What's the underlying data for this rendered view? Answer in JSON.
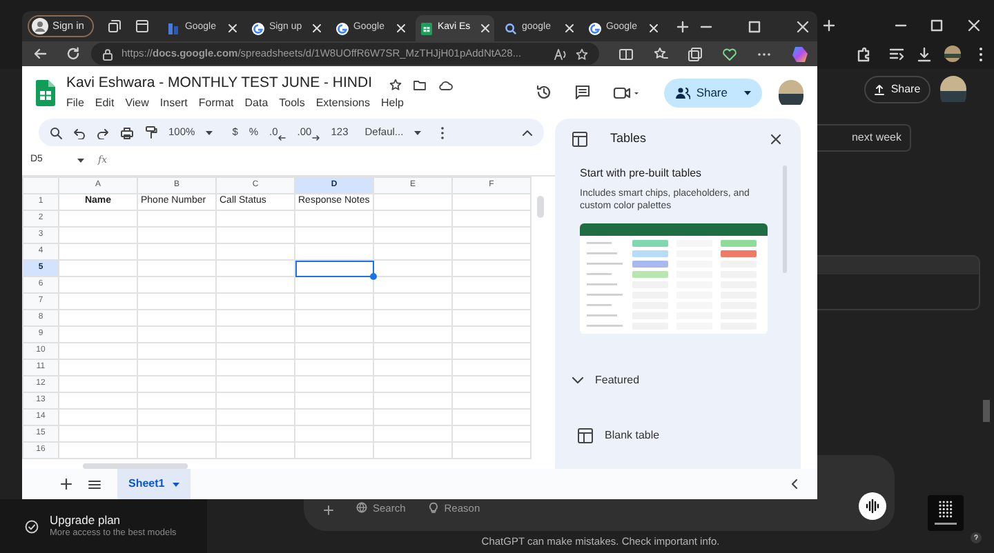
{
  "desktop": {
    "share_label": "Share",
    "chip": "next week",
    "upgrade": {
      "title": "Upgrade plan",
      "subtitle": "More access to the best models"
    },
    "composer_tools": [
      "Search",
      "Reason"
    ],
    "disclaimer": "ChatGPT can make mistakes. Check important info."
  },
  "browser": {
    "profile_label": "Sign in",
    "tabs": [
      {
        "kind": "docs",
        "label": "Google",
        "selected": false
      },
      {
        "kind": "google",
        "label": "Sign up",
        "selected": false
      },
      {
        "kind": "google",
        "label": "Google",
        "selected": false
      },
      {
        "kind": "sheets",
        "label": "Kavi Es",
        "selected": true
      },
      {
        "kind": "search",
        "label": "google",
        "selected": false
      },
      {
        "kind": "google",
        "label": "Google",
        "selected": false
      }
    ],
    "url": "https://**docs.google.com**/spreadsheets/d/1W8UOffR6W7SR_MzTHJjH01pAddNtA28..."
  },
  "sheets": {
    "title": "Kavi Eshwara - MONTHLY TEST JUNE - HINDI",
    "menus": [
      "File",
      "Edit",
      "View",
      "Insert",
      "Format",
      "Data",
      "Tools",
      "Extensions",
      "Help"
    ],
    "share_label": "Share",
    "toolbar": {
      "zoom": "100%",
      "currency": "$",
      "percent": "%",
      "decrease_decimals": ".0",
      "increase_decimals": ".00",
      "number_format": "123",
      "font": "Defaul..."
    },
    "name_box": "D5",
    "formula_label": "fx",
    "columns": [
      {
        "label": "A",
        "selected": false
      },
      {
        "label": "B",
        "selected": false
      },
      {
        "label": "C",
        "selected": false
      },
      {
        "label": "D",
        "selected": true
      },
      {
        "label": "E",
        "selected": false
      },
      {
        "label": "F",
        "selected": false
      }
    ],
    "rows": [
      {
        "label": "1",
        "selected": false,
        "cells": [
          {
            "text": "Name",
            "bold": true
          },
          {
            "text": "Phone Number",
            "bold": false
          },
          {
            "text": "Call Status",
            "bold": false
          },
          {
            "text": "Response Notes",
            "bold": false
          }
        ]
      },
      {
        "label": "2",
        "selected": false
      },
      {
        "label": "3",
        "selected": false
      },
      {
        "label": "4",
        "selected": false
      },
      {
        "label": "5",
        "selected": true
      },
      {
        "label": "6",
        "selected": false
      },
      {
        "label": "7",
        "selected": false
      },
      {
        "label": "8",
        "selected": false
      },
      {
        "label": "9",
        "selected": false
      },
      {
        "label": "10",
        "selected": false
      },
      {
        "label": "11",
        "selected": false
      },
      {
        "label": "12",
        "selected": false
      },
      {
        "label": "13",
        "selected": false
      },
      {
        "label": "14",
        "selected": false
      },
      {
        "label": "15",
        "selected": false
      },
      {
        "label": "16",
        "selected": false
      }
    ],
    "sheet_tabs": [
      {
        "label": "Sheet1",
        "selected": true
      }
    ],
    "panel": {
      "title": "Tables",
      "heading": "Start with pre-built tables",
      "description": "Includes smart chips, placeholders, and custom color palettes",
      "section": {
        "label": "Featured",
        "expanded": true
      },
      "items": [
        "Blank table"
      ]
    }
  }
}
